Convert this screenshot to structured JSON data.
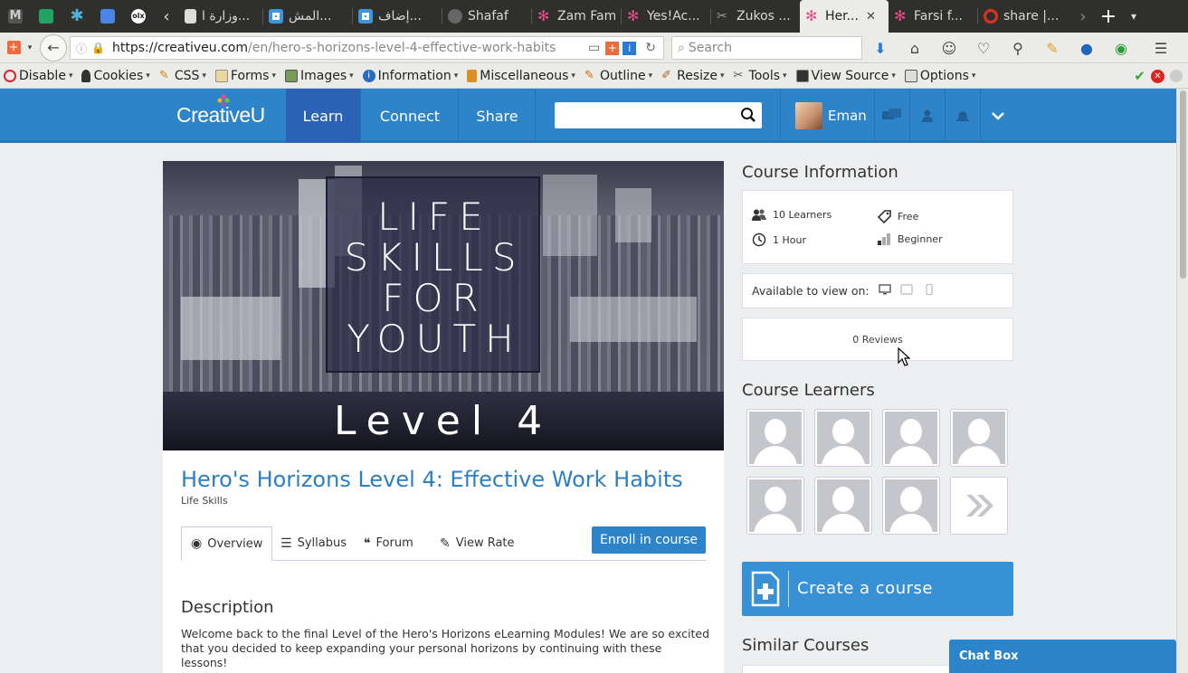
{
  "browser": {
    "tabs": [
      {
        "label": "",
        "icon": "gmail-icon",
        "color": "#888888",
        "pinned": true
      },
      {
        "label": "",
        "icon": "sheets-icon",
        "color": "#1fa463",
        "pinned": true
      },
      {
        "label": "",
        "icon": "asterisk-icon",
        "color": "#4fb3d9",
        "pinned": true
      },
      {
        "label": "",
        "icon": "docs-icon",
        "color": "#4a86e8",
        "pinned": true
      },
      {
        "label": "",
        "icon": "olx-icon",
        "color": "#ffffff",
        "pinned": true
      },
      {
        "label": "",
        "icon": "chevron-left-icon",
        "color": "#dddddd",
        "pinned": true
      },
      {
        "label": "وزارة ا...",
        "icon": "page-icon",
        "color": "#cccccc"
      },
      {
        "label": "المش...",
        "icon": "ring-icon",
        "color": "#3d95dc"
      },
      {
        "label": "إضاف...",
        "icon": "ring-icon",
        "color": "#3d95dc"
      },
      {
        "label": "Shafaf",
        "icon": "gray-circle-icon",
        "color": "#777777"
      },
      {
        "label": "Zam Fam",
        "icon": "star-icon",
        "color": "#e84c8b"
      },
      {
        "label": "Yes!Ac...",
        "icon": "star-icon",
        "color": "#e84c8b"
      },
      {
        "label": "Zukos ...",
        "icon": "tools-icon",
        "color": "#999999"
      },
      {
        "label": "Her...",
        "icon": "star-icon",
        "color": "#e84c8b",
        "active": true
      },
      {
        "label": "Farsi f...",
        "icon": "star-icon",
        "color": "#e84c8b"
      },
      {
        "label": "share |...",
        "icon": "opera-icon",
        "color": "#e0301e"
      }
    ],
    "url_host": "https://creativeu.com",
    "url_path": "/en/hero-s-horizons-level-4-effective-work-habits",
    "search_placeholder": "Search"
  },
  "devbar": {
    "items": [
      "Disable",
      "Cookies",
      "CSS",
      "Forms",
      "Images",
      "Information",
      "Miscellaneous",
      "Outline",
      "Resize",
      "Tools",
      "View Source",
      "Options"
    ]
  },
  "site": {
    "logo": "CreativeU",
    "nav": [
      "Learn",
      "Connect",
      "Share"
    ],
    "active_nav": "Learn",
    "user_name": "Eman",
    "brand_color": "#2e84c8"
  },
  "course": {
    "hero_lines": [
      "LIFE",
      "SKILLS",
      "FOR",
      "YOUTH"
    ],
    "level_text": "Level 4",
    "title": "Hero's Horizons Level 4: Effective Work Habits",
    "category": "Life Skills",
    "tabs": [
      "Overview",
      "Syllabus",
      "Forum",
      "View Rate"
    ],
    "active_tab": "Overview",
    "enroll_label": "Enroll in course",
    "description_heading": "Description",
    "description_text": "Welcome back to the final Level of the Hero's Horizons eLearning Modules! We are so excited that you decided to keep expanding your personal horizons by continuing with these lessons!"
  },
  "sidebar": {
    "info_heading": "Course Information",
    "learners_count": "10 Learners",
    "price": "Free",
    "duration": "1 Hour",
    "level": "Beginner",
    "available_label": "Available to view on:",
    "reviews": "0 Reviews",
    "learners_heading": "Course Learners",
    "learners_shown": 7,
    "create_label": "Create a course",
    "similar_heading": "Similar Courses",
    "chat_label": "Chat Box"
  }
}
